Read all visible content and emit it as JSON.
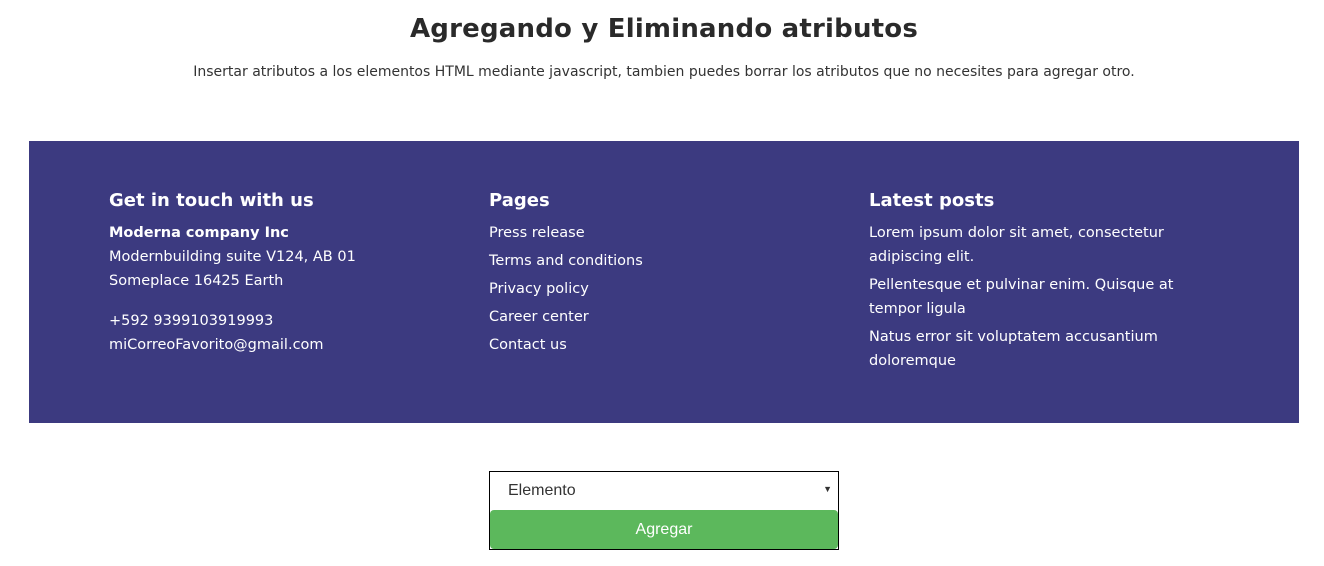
{
  "page": {
    "title": "Agregando y Eliminando atributos",
    "subtitle": "Insertar atributos a los elementos HTML mediante javascript, tambien puedes borrar los atributos que no necesites para agregar otro."
  },
  "footer": {
    "background_color": "#3c3a80",
    "contact": {
      "heading": "Get in touch with us",
      "company": "Moderna company Inc",
      "address_line1": "Modernbuilding suite V124, AB 01",
      "address_line2": "Someplace 16425 Earth",
      "phone": "+592 9399103919993",
      "email": "miCorreoFavorito@gmail.com"
    },
    "pages": {
      "heading": "Pages",
      "links": [
        "Press release",
        "Terms and conditions",
        "Privacy policy",
        "Career center",
        "Contact us"
      ]
    },
    "posts": {
      "heading": "Latest posts",
      "items": [
        "Lorem ipsum dolor sit amet, consectetur adipiscing elit.",
        "Pellentesque et pulvinar enim. Quisque at tempor ligula",
        "Natus error sit voluptatem accusantium doloremque"
      ]
    }
  },
  "form": {
    "select_value": "Elemento",
    "select_icon": "caret-down-icon",
    "add_button_label": "Agregar",
    "add_button_color": "#5cb85c"
  }
}
